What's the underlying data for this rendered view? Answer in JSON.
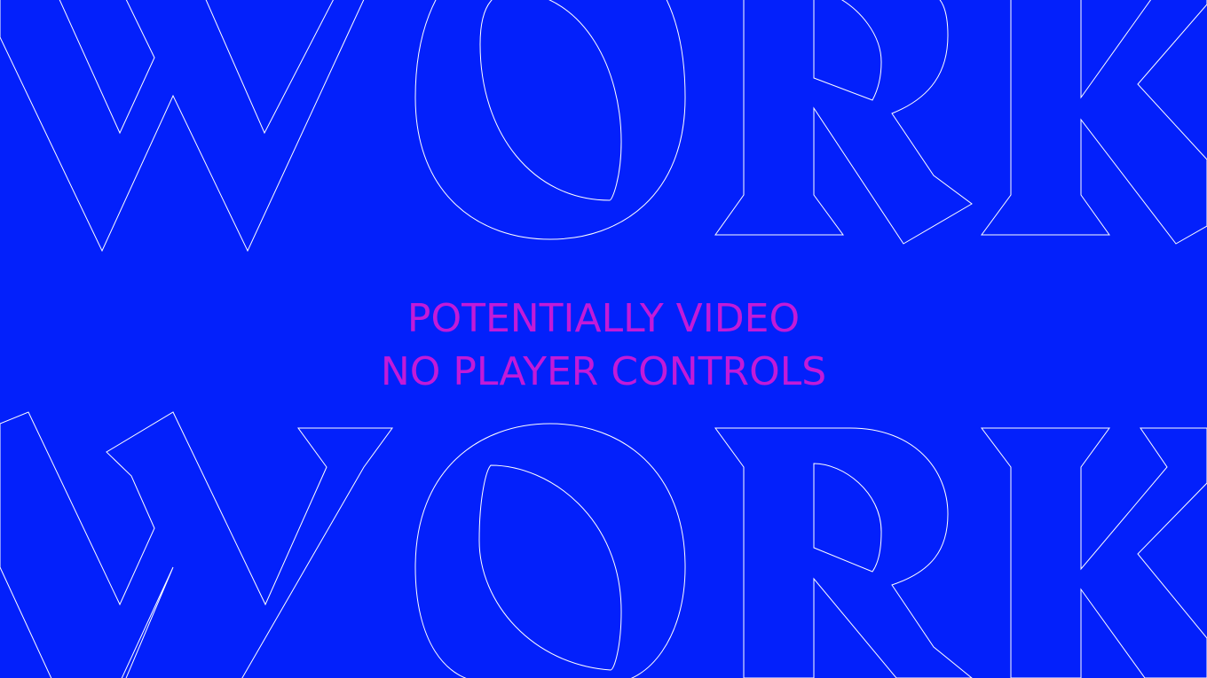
{
  "background_word_rows": [
    "WORK",
    "WORK"
  ],
  "caption": {
    "line1": "POTENTIALLY VIDEO",
    "line2": "NO PLAYER CONTROLS"
  },
  "colors": {
    "background": "#0320fb",
    "outline": "#ffffff",
    "caption": "#c21ad8"
  }
}
